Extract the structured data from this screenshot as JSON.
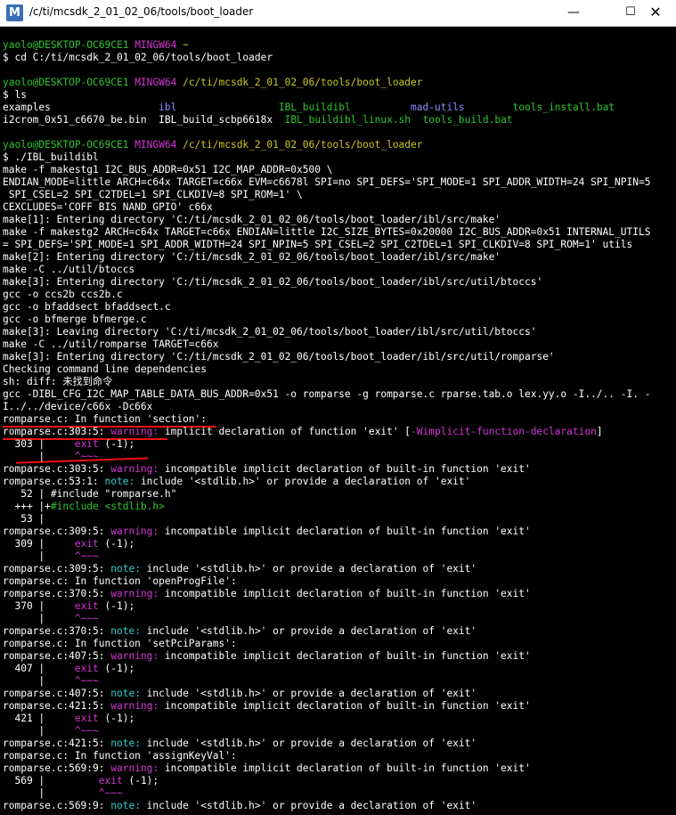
{
  "window": {
    "title": "/c/ti/mcsdk_2_01_02_06/tools/boot_loader",
    "app_icon_letter": "M",
    "controls": {
      "minimize": "—",
      "maximize": "☐",
      "close": "✕"
    }
  },
  "colors": {
    "background": "#000000",
    "text": "#ffffff",
    "user_host": "#2ec52e",
    "mingw": "#d335d3",
    "path": "#c8c81e",
    "warning": "#d335d3",
    "note": "#30d0d0",
    "fix_hint": "#2ec52e",
    "annotation": "#ee1111"
  },
  "terminal": {
    "lines": [
      {
        "segments": []
      },
      {
        "segments": [
          {
            "t": "yaolo@DESKTOP-OC69CE1 ",
            "c": "g"
          },
          {
            "t": "MINGW64 ",
            "c": "m"
          },
          {
            "t": "~",
            "c": "y"
          }
        ]
      },
      {
        "segments": [
          {
            "t": "$ cd C:/ti/mcsdk_2_01_02_06/tools/boot_loader"
          }
        ]
      },
      {
        "segments": []
      },
      {
        "segments": [
          {
            "t": "yaolo@DESKTOP-OC69CE1 ",
            "c": "g"
          },
          {
            "t": "MINGW64 ",
            "c": "m"
          },
          {
            "t": "/c/ti/mcsdk_2_01_02_06/tools/boot_loader",
            "c": "y"
          }
        ]
      },
      {
        "segments": [
          {
            "t": "$ ls"
          }
        ]
      },
      {
        "segments": [
          {
            "t": "examples                  "
          },
          {
            "t": "ibl",
            "c": "b"
          },
          {
            "t": "                 "
          },
          {
            "t": "IBL_buildibl",
            "c": "g"
          },
          {
            "t": "          "
          },
          {
            "t": "mad-utils",
            "c": "b"
          },
          {
            "t": "        "
          },
          {
            "t": "tools_install.bat",
            "c": "g"
          }
        ]
      },
      {
        "segments": [
          {
            "t": "i2crom_0x51_c6670_be.bin  IBL_build_scbp6618x  "
          },
          {
            "t": "IBL_buildibl_linux.sh",
            "c": "g"
          },
          {
            "t": "  "
          },
          {
            "t": "tools_build.bat",
            "c": "g"
          }
        ]
      },
      {
        "segments": []
      },
      {
        "segments": [
          {
            "t": "yaolo@DESKTOP-OC69CE1 ",
            "c": "g"
          },
          {
            "t": "MINGW64 ",
            "c": "m"
          },
          {
            "t": "/c/ti/mcsdk_2_01_02_06/tools/boot_loader",
            "c": "y"
          }
        ]
      },
      {
        "segments": [
          {
            "t": "$ ./IBL_buildibl"
          }
        ]
      },
      {
        "segments": [
          {
            "t": "make -f makestg1 I2C_BUS_ADDR=0x51 I2C_MAP_ADDR=0x500 \\"
          }
        ]
      },
      {
        "segments": [
          {
            "t": "ENDIAN_MODE=little ARCH=c64x TARGET=c66x EVM=c6678l SPI=no SPI_DEFS='SPI_MODE=1 SPI_ADDR_WIDTH=24 SPI_NPIN=5"
          }
        ]
      },
      {
        "segments": [
          {
            "t": " SPI_CSEL=2 SPI_C2TDEL=1 SPI_CLKDIV=8 SPI_ROM=1' \\"
          }
        ]
      },
      {
        "segments": [
          {
            "t": "CEXCLUDES='COFF BIS NAND_GPIO' c66x"
          }
        ]
      },
      {
        "segments": [
          {
            "t": "make[1]: Entering directory 'C:/ti/mcsdk_2_01_02_06/tools/boot_loader/ibl/src/make'"
          }
        ]
      },
      {
        "segments": [
          {
            "t": "make -f makestg2 ARCH=c64x TARGET=c66x ENDIAN=little I2C_SIZE_BYTES=0x20000 I2C_BUS_ADDR=0x51 INTERNAL_UTILS"
          }
        ]
      },
      {
        "segments": [
          {
            "t": "= SPI_DEFS='SPI_MODE=1 SPI_ADDR_WIDTH=24 SPI_NPIN=5 SPI_CSEL=2 SPI_C2TDEL=1 SPI_CLKDIV=8 SPI_ROM=1' utils"
          }
        ]
      },
      {
        "segments": [
          {
            "t": "make[2]: Entering directory 'C:/ti/mcsdk_2_01_02_06/tools/boot_loader/ibl/src/make'"
          }
        ]
      },
      {
        "segments": [
          {
            "t": "make -C ../util/btoccs"
          }
        ]
      },
      {
        "segments": [
          {
            "t": "make[3]: Entering directory 'C:/ti/mcsdk_2_01_02_06/tools/boot_loader/ibl/src/util/btoccs'"
          }
        ]
      },
      {
        "segments": [
          {
            "t": "gcc -o ccs2b ccs2b.c"
          }
        ]
      },
      {
        "segments": [
          {
            "t": "gcc -o bfaddsect bfaddsect.c"
          }
        ]
      },
      {
        "segments": [
          {
            "t": "gcc -o bfmerge bfmerge.c"
          }
        ]
      },
      {
        "segments": [
          {
            "t": "make[3]: Leaving directory 'C:/ti/mcsdk_2_01_02_06/tools/boot_loader/ibl/src/util/btoccs'"
          }
        ]
      },
      {
        "segments": [
          {
            "t": "make -C ../util/romparse TARGET=c66x"
          }
        ]
      },
      {
        "segments": [
          {
            "t": "make[3]: Entering directory 'C:/ti/mcsdk_2_01_02_06/tools/boot_loader/ibl/src/util/romparse'"
          }
        ]
      },
      {
        "segments": [
          {
            "t": "Checking command line dependencies"
          }
        ]
      },
      {
        "segments": [
          {
            "t": "sh: diff: 未找到命令"
          }
        ]
      },
      {
        "segments": [
          {
            "t": "gcc -DIBL_CFG_I2C_MAP_TABLE_DATA_BUS_ADDR=0x51 -o romparse -g romparse.c rparse.tab.o lex.yy.o -I../.. -I. -"
          }
        ]
      },
      {
        "segments": [
          {
            "t": "I../../device/c66x -Dc66x"
          }
        ]
      },
      {
        "segments": [
          {
            "t": "romparse.c: In function 'section':"
          }
        ]
      },
      {
        "segments": [
          {
            "t": "romparse.c:303:5: "
          },
          {
            "t": "warning:",
            "c": "m"
          },
          {
            "t": " implicit declaration of function 'exit' ["
          },
          {
            "t": "-Wimplicit-function-declaration",
            "c": "m"
          },
          {
            "t": "]"
          }
        ]
      },
      {
        "segments": [
          {
            "t": "  303 |     "
          },
          {
            "t": "exit",
            "c": "m"
          },
          {
            "t": " (-1);"
          }
        ]
      },
      {
        "segments": [
          {
            "t": "      |     "
          },
          {
            "t": "^~~~",
            "c": "m"
          }
        ]
      },
      {
        "segments": [
          {
            "t": "romparse.c:303:5: "
          },
          {
            "t": "warning:",
            "c": "m"
          },
          {
            "t": " incompatible implicit declaration of built-in function 'exit'"
          }
        ]
      },
      {
        "segments": [
          {
            "t": "romparse.c:53:1: "
          },
          {
            "t": "note:",
            "c": "c"
          },
          {
            "t": " include '<stdlib.h>' or provide a declaration of 'exit'"
          }
        ]
      },
      {
        "segments": [
          {
            "t": "   52 | #include \"romparse.h\""
          }
        ]
      },
      {
        "segments": [
          {
            "t": "  +++ |+"
          },
          {
            "t": "#include <stdlib.h>",
            "c": "g"
          }
        ]
      },
      {
        "segments": [
          {
            "t": "   53 |"
          }
        ]
      },
      {
        "segments": [
          {
            "t": "romparse.c:309:5: "
          },
          {
            "t": "warning:",
            "c": "m"
          },
          {
            "t": " incompatible implicit declaration of built-in function 'exit'"
          }
        ]
      },
      {
        "segments": [
          {
            "t": "  309 |     "
          },
          {
            "t": "exit",
            "c": "m"
          },
          {
            "t": " (-1);"
          }
        ]
      },
      {
        "segments": [
          {
            "t": "      |     "
          },
          {
            "t": "^~~~",
            "c": "m"
          }
        ]
      },
      {
        "segments": [
          {
            "t": "romparse.c:309:5: "
          },
          {
            "t": "note:",
            "c": "c"
          },
          {
            "t": " include '<stdlib.h>' or provide a declaration of 'exit'"
          }
        ]
      },
      {
        "segments": [
          {
            "t": "romparse.c: In function 'openProgFile':"
          }
        ]
      },
      {
        "segments": [
          {
            "t": "romparse.c:370:5: "
          },
          {
            "t": "warning:",
            "c": "m"
          },
          {
            "t": " incompatible implicit declaration of built-in function 'exit'"
          }
        ]
      },
      {
        "segments": [
          {
            "t": "  370 |     "
          },
          {
            "t": "exit",
            "c": "m"
          },
          {
            "t": " (-1);"
          }
        ]
      },
      {
        "segments": [
          {
            "t": "      |     "
          },
          {
            "t": "^~~~",
            "c": "m"
          }
        ]
      },
      {
        "segments": [
          {
            "t": "romparse.c:370:5: "
          },
          {
            "t": "note:",
            "c": "c"
          },
          {
            "t": " include '<stdlib.h>' or provide a declaration of 'exit'"
          }
        ]
      },
      {
        "segments": [
          {
            "t": "romparse.c: In function 'setPciParams':"
          }
        ]
      },
      {
        "segments": [
          {
            "t": "romparse.c:407:5: "
          },
          {
            "t": "warning:",
            "c": "m"
          },
          {
            "t": " incompatible implicit declaration of built-in function 'exit'"
          }
        ]
      },
      {
        "segments": [
          {
            "t": "  407 |     "
          },
          {
            "t": "exit",
            "c": "m"
          },
          {
            "t": " (-1);"
          }
        ]
      },
      {
        "segments": [
          {
            "t": "      |     "
          },
          {
            "t": "^~~~",
            "c": "m"
          }
        ]
      },
      {
        "segments": [
          {
            "t": "romparse.c:407:5: "
          },
          {
            "t": "note:",
            "c": "c"
          },
          {
            "t": " include '<stdlib.h>' or provide a declaration of 'exit'"
          }
        ]
      },
      {
        "segments": [
          {
            "t": "romparse.c:421:5: "
          },
          {
            "t": "warning:",
            "c": "m"
          },
          {
            "t": " incompatible implicit declaration of built-in function 'exit'"
          }
        ]
      },
      {
        "segments": [
          {
            "t": "  421 |     "
          },
          {
            "t": "exit",
            "c": "m"
          },
          {
            "t": " (-1);"
          }
        ]
      },
      {
        "segments": [
          {
            "t": "      |     "
          },
          {
            "t": "^~~~",
            "c": "m"
          }
        ]
      },
      {
        "segments": [
          {
            "t": "romparse.c:421:5: "
          },
          {
            "t": "note:",
            "c": "c"
          },
          {
            "t": " include '<stdlib.h>' or provide a declaration of 'exit'"
          }
        ]
      },
      {
        "segments": [
          {
            "t": "romparse.c: In function 'assignKeyVal':"
          }
        ]
      },
      {
        "segments": [
          {
            "t": "romparse.c:569:9: "
          },
          {
            "t": "warning:",
            "c": "m"
          },
          {
            "t": " incompatible implicit declaration of built-in function 'exit'"
          }
        ]
      },
      {
        "segments": [
          {
            "t": "  569 |         "
          },
          {
            "t": "exit",
            "c": "m"
          },
          {
            "t": " (-1);"
          }
        ]
      },
      {
        "segments": [
          {
            "t": "      |         "
          },
          {
            "t": "^~~~",
            "c": "m"
          }
        ]
      },
      {
        "segments": [
          {
            "t": "romparse.c:569:9: "
          },
          {
            "t": "note:",
            "c": "c"
          },
          {
            "t": " include '<stdlib.h>' or provide a declaration of 'exit'"
          }
        ]
      }
    ]
  }
}
